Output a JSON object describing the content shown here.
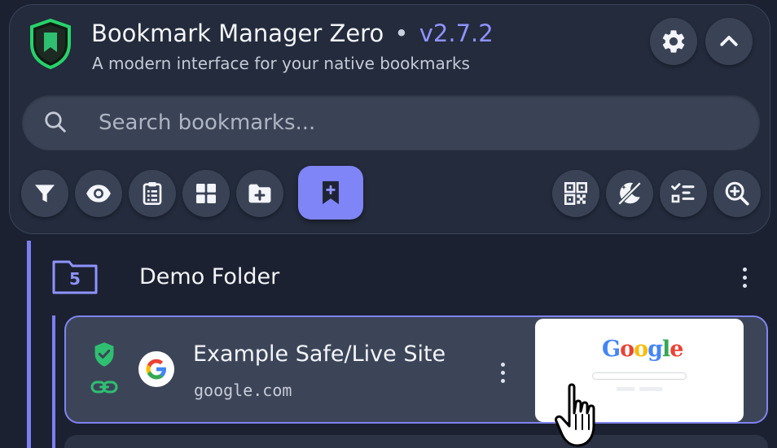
{
  "app": {
    "title": "Bookmark Manager Zero",
    "separator": "•",
    "version": "v2.7.2",
    "subtitle": "A modern interface for your native bookmarks"
  },
  "header_buttons": [
    {
      "icon": "gear-icon"
    },
    {
      "icon": "chevron-up-icon"
    }
  ],
  "search": {
    "placeholder": "Search bookmarks...",
    "value": ""
  },
  "toolbar": {
    "left": [
      "filter-icon",
      "eye-icon",
      "clipboard-list-icon",
      "grid-icon",
      "folder-plus-icon",
      "bookmark-plus-icon"
    ],
    "active": "bookmark-plus-icon",
    "right": [
      "qr-code-icon",
      "theme-toggle-icon",
      "checklist-icon",
      "zoom-in-icon"
    ]
  },
  "folder": {
    "name": "Demo Folder",
    "count": "5"
  },
  "bookmark": {
    "title": "Example Safe/Live Site",
    "url": "google.com",
    "status_icons": [
      "shield-check-icon",
      "link-icon"
    ],
    "favicon": "google-favicon-icon",
    "preview_logo": "Google"
  },
  "colors": {
    "accent": "#8184f2",
    "safe_green": "#2fbf71",
    "background": "#1b2130",
    "panel": "#232b3c",
    "button": "#3a4356"
  }
}
